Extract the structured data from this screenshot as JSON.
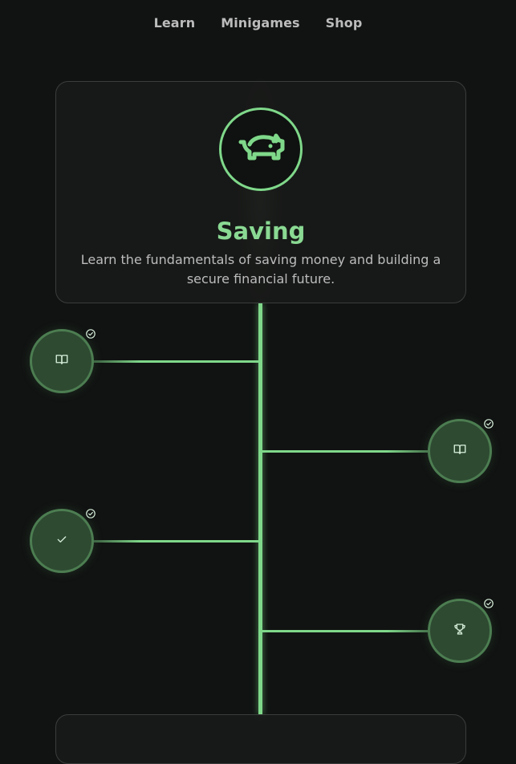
{
  "nav": {
    "items": [
      {
        "label": "Learn"
      },
      {
        "label": "Minigames"
      },
      {
        "label": "Shop"
      }
    ]
  },
  "unit": {
    "icon": "piggy-bank-icon",
    "title": "Saving",
    "description": "Learn the fundamentals of saving money and building a secure financial future."
  },
  "lessons": [
    {
      "icon": "book-icon",
      "status": "completed",
      "side": "left"
    },
    {
      "icon": "book-icon",
      "status": "completed",
      "side": "right"
    },
    {
      "icon": "check-icon",
      "status": "completed",
      "side": "left"
    },
    {
      "icon": "trophy-icon",
      "status": "completed",
      "side": "right"
    }
  ],
  "colors": {
    "accent": "#7fd88a",
    "background": "#111312",
    "node_fill": "#2e4a31",
    "node_border": "#4c7d51"
  }
}
